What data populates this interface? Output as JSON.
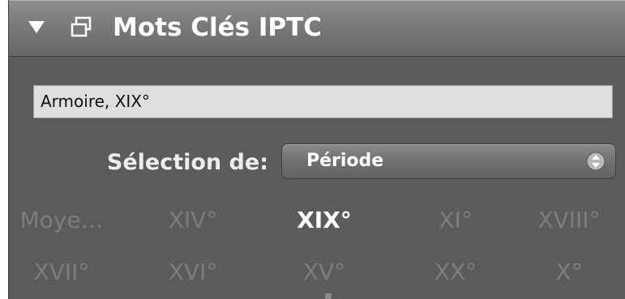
{
  "panel": {
    "title": "Mots Clés IPTC",
    "keywords_value": "Armoire, XIX°",
    "selection_label": "Sélection de:",
    "selection_value": "Période",
    "tags_row1": [
      "Moye…",
      "XIV°",
      "XIX°",
      "XI°",
      "XVIII°"
    ],
    "tags_row2": [
      "XVII°",
      "XVI°",
      "XV°",
      "XX°",
      "X°"
    ],
    "active_tag": "XIX°"
  },
  "colors": {
    "panel_bg": "#5b5b5b",
    "header_bg": "#7a7a7a",
    "field_bg": "#dedede",
    "inactive_tag": "#7c7c7c",
    "active_tag": "#ffffff"
  },
  "icons": {
    "disclosure": "disclosure-triangle-icon",
    "window": "window-icon",
    "popup": "updown-arrows-icon"
  }
}
